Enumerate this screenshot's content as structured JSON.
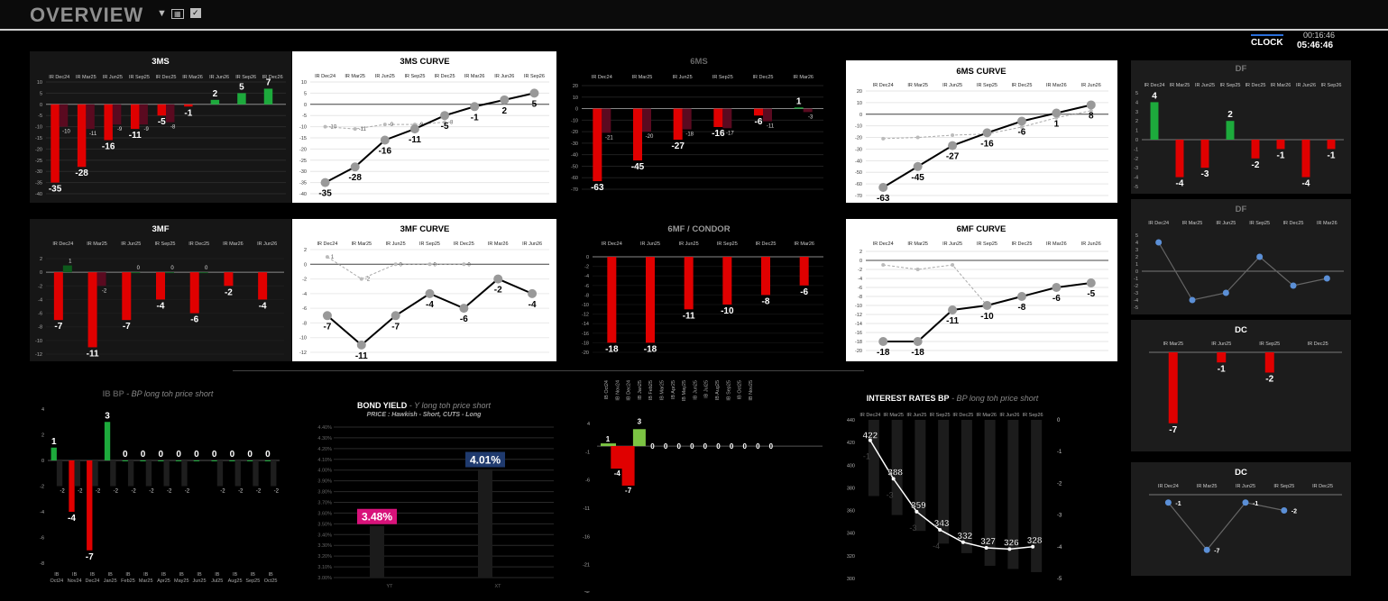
{
  "header": {
    "title": "OVERVIEW",
    "clock_label": "CLOCK",
    "clock_elapsed": "00:16:46",
    "clock_time": "05:46:46"
  },
  "colors": {
    "neg": "#e00000",
    "pos": "#1daa3c",
    "neg_dark": "#5a0a20",
    "pos_dark": "#0d5a1c",
    "gray": "#333333",
    "bond_yt": "#d8127a",
    "bond_xt": "#1f3a6e",
    "blue": "#5b8fd6",
    "bright_green": "#7cc443"
  },
  "chart_data": [
    {
      "id": "c3ms",
      "type": "bar",
      "title": "3MS",
      "theme": "dark",
      "categories": [
        "IR Dec24",
        "IR Mar25",
        "IR Jun25",
        "IR Sep25",
        "IR Dec25",
        "IR Mar26",
        "IR Jun26",
        "IR Sep26",
        "IR Dec26"
      ],
      "series": [
        {
          "role": "main",
          "values": [
            -35,
            -28,
            -16,
            -11,
            -5,
            -1,
            2,
            5,
            7
          ],
          "labels": [
            "-35",
            "-28",
            "-16",
            "-11",
            "-5",
            "-1",
            "2",
            "5",
            "7"
          ]
        },
        {
          "role": "prev",
          "values": [
            -10,
            -11,
            -9,
            -9,
            -8,
            null,
            null,
            null,
            null
          ],
          "labels": [
            "-10",
            "-11",
            "-9",
            "-9",
            "-8",
            "",
            "",
            "",
            ""
          ]
        }
      ],
      "ylim": [
        -40,
        10
      ],
      "yticks": [
        10,
        5,
        0,
        -5,
        -10,
        -15,
        -20,
        -25,
        -30,
        -35,
        -40
      ]
    },
    {
      "id": "c3msc",
      "type": "line",
      "title": "3MS CURVE",
      "theme": "light",
      "categories": [
        "IR Dec24",
        "IR Mar25",
        "IR Jun25",
        "IR Sep25",
        "IR Dec25",
        "IR Mar26",
        "IR Jun26",
        "IR Sep26"
      ],
      "series": [
        {
          "role": "main",
          "values": [
            -35,
            -28,
            -16,
            -11,
            -5,
            -1,
            2,
            5
          ],
          "labels": [
            "-35",
            "-28",
            "-16",
            "-11",
            "-5",
            "-1",
            "2",
            "5"
          ]
        },
        {
          "role": "prev",
          "values": [
            -10,
            -11,
            -9,
            -9,
            -8,
            null,
            null,
            null
          ],
          "labels": [
            "-10",
            "-11",
            "-9",
            "-9",
            "-8",
            "",
            "",
            ""
          ]
        }
      ],
      "ylim": [
        -40,
        10
      ],
      "yticks": [
        10,
        5,
        0,
        -5,
        -10,
        -15,
        -20,
        -25,
        -30,
        -35,
        -40
      ]
    },
    {
      "id": "c6ms",
      "type": "bar",
      "title": "6MS",
      "theme": "dark",
      "categories": [
        "IR Dec24",
        "IR Mar25",
        "IR Jun25",
        "IR Sep25",
        "IR Dec25",
        "IR Mar26"
      ],
      "series": [
        {
          "role": "main",
          "values": [
            -63,
            -45,
            -27,
            -16,
            -6,
            1
          ],
          "labels": [
            "-63",
            "-45",
            "-27",
            "-16",
            "-6",
            "1"
          ]
        },
        {
          "role": "prev",
          "values": [
            -21,
            -20,
            -18,
            -17,
            -11,
            -3
          ],
          "labels": [
            "-21",
            "-20",
            "-18",
            "-17",
            "-11",
            "-3"
          ]
        }
      ],
      "ylim": [
        -70,
        20
      ],
      "yticks": [
        20,
        10,
        0,
        -10,
        -20,
        -30,
        -40,
        -50,
        -60,
        -70
      ]
    },
    {
      "id": "c6msc",
      "type": "line",
      "title": "6MS CURVE",
      "theme": "light",
      "categories": [
        "IR Dec24",
        "IR Mar25",
        "IR Jun25",
        "IR Sep25",
        "IR Dec25",
        "IR Mar26",
        "IR Jun26"
      ],
      "series": [
        {
          "role": "main",
          "values": [
            -63,
            -45,
            -27,
            -16,
            -6,
            1,
            8
          ],
          "labels": [
            "-63",
            "-45",
            "-27",
            "-16",
            "-6",
            "1",
            "8"
          ]
        },
        {
          "role": "prev",
          "values": [
            -21,
            -20,
            -18,
            -17,
            -11,
            -3,
            3
          ],
          "labels": [
            "",
            "",
            "",
            "",
            "",
            "",
            ""
          ]
        }
      ],
      "ylim": [
        -70,
        20
      ],
      "yticks": [
        20,
        10,
        0,
        -10,
        -20,
        -30,
        -40,
        -50,
        -60,
        -70
      ]
    },
    {
      "id": "cdf1",
      "type": "bar",
      "title": "DF",
      "theme": "dark2",
      "categories": [
        "IR Dec24",
        "IR Mar25",
        "IR Jun25",
        "IR Sep25",
        "IR Dec25",
        "IR Mar26",
        "IR Jun26",
        "IR Sep26"
      ],
      "series": [
        {
          "role": "main",
          "values": [
            4,
            -4,
            -3,
            2,
            -2,
            -1,
            -4,
            -1
          ],
          "labels": [
            "4",
            "-4",
            "-3",
            "2",
            "-2",
            "-1",
            "-4",
            "-1"
          ]
        }
      ],
      "ylim": [
        -5,
        5
      ],
      "yticks": [
        5,
        4,
        3,
        2,
        1,
        0,
        -1,
        -2,
        -3,
        -4,
        -5
      ]
    },
    {
      "id": "c3mf",
      "type": "bar",
      "title": "3MF",
      "theme": "dark",
      "categories": [
        "IR Dec24",
        "IR Mar25",
        "IR Jun25",
        "IR Sep25",
        "IR Dec25",
        "IR Mar26",
        "IR Jun26"
      ],
      "series": [
        {
          "role": "main",
          "values": [
            -7,
            -11,
            -7,
            -4,
            -6,
            -2,
            -4
          ],
          "labels": [
            "-7",
            "-11",
            "-7",
            "-4",
            "-6",
            "-2",
            "-4"
          ]
        },
        {
          "role": "prev",
          "values": [
            1,
            -2,
            0,
            0,
            0,
            null,
            null
          ],
          "labels": [
            "1",
            "-2",
            "0",
            "0",
            "0",
            "",
            ""
          ]
        }
      ],
      "ylim": [
        -12,
        2
      ],
      "yticks": [
        2,
        0,
        -2,
        -4,
        -6,
        -8,
        -10,
        -12
      ]
    },
    {
      "id": "c3mfc",
      "type": "line",
      "title": "3MF CURVE",
      "theme": "light",
      "categories": [
        "IR Dec24",
        "IR Mar25",
        "IR Jun25",
        "IR Sep25",
        "IR Dec25",
        "IR Mar26",
        "IR Jun26"
      ],
      "series": [
        {
          "role": "main",
          "values": [
            -7,
            -11,
            -7,
            -4,
            -6,
            -2,
            -4
          ],
          "labels": [
            "-7",
            "-11",
            "-7",
            "-4",
            "-6",
            "-2",
            "-4"
          ]
        },
        {
          "role": "prev",
          "values": [
            1,
            -2,
            0,
            0,
            0,
            null,
            null
          ],
          "labels": [
            "1",
            "-2",
            "0",
            "0",
            "0",
            "",
            ""
          ]
        }
      ],
      "ylim": [
        -12,
        2
      ],
      "yticks": [
        2,
        0,
        -2,
        -4,
        -6,
        -8,
        -10,
        -12
      ]
    },
    {
      "id": "c6mf",
      "type": "bar",
      "title": "6MF / CONDOR",
      "theme": "dark",
      "categories": [
        "IR Dec24",
        "IR Jun25",
        "IR Jun25",
        "IR Sep25",
        "IR Dec25",
        "IR Mar26"
      ],
      "series": [
        {
          "role": "main",
          "values": [
            -18,
            -18,
            -11,
            -10,
            -8,
            -6
          ],
          "labels": [
            "-18",
            "-18",
            "-11",
            "-10",
            "-8",
            "-6"
          ]
        }
      ],
      "ylim": [
        -20,
        0
      ],
      "yticks": [
        0,
        -2,
        -4,
        -6,
        -8,
        -10,
        -12,
        -14,
        -16,
        -18,
        -20
      ]
    },
    {
      "id": "c6mfc",
      "type": "line",
      "title": "6MF CURVE",
      "theme": "light",
      "categories": [
        "IR Dec24",
        "IR Mar25",
        "IR Jun25",
        "IR Sep25",
        "IR Dec25",
        "IR Mar26",
        "IR Jun26"
      ],
      "series": [
        {
          "role": "main",
          "values": [
            -18,
            -18,
            -11,
            -10,
            -8,
            -6,
            -5
          ],
          "labels": [
            "-18",
            "-18",
            "-11",
            "-10",
            "-8",
            "-6",
            "-5"
          ]
        },
        {
          "role": "prev",
          "values": [
            -1,
            -2,
            -1,
            -10,
            -8,
            -6,
            -5
          ],
          "labels": [
            "",
            "",
            "",
            "",
            "",
            "",
            ""
          ]
        }
      ],
      "ylim": [
        -20,
        2
      ],
      "yticks": [
        2,
        0,
        -2,
        -4,
        -6,
        -8,
        -10,
        -12,
        -14,
        -16,
        -18,
        -20
      ]
    },
    {
      "id": "cdf2",
      "type": "line",
      "title": "DF",
      "theme": "dark2",
      "categories": [
        "IR Dec24",
        "IR Mar25",
        "IR Jun25",
        "IR Sep25",
        "IR Dec25",
        "IR Mar26"
      ],
      "series": [
        {
          "role": "main",
          "values": [
            4,
            -4,
            -3,
            2,
            -2,
            -1
          ],
          "labels": [
            "",
            "",
            "",
            "",
            "",
            ""
          ]
        }
      ],
      "ylim": [
        -5,
        5
      ],
      "yticks": [
        5,
        4,
        3,
        2,
        1,
        0,
        -1,
        -2,
        -3,
        -4,
        -5
      ]
    },
    {
      "id": "cdc1",
      "type": "bar",
      "title": "DC",
      "theme": "dark2",
      "categories": [
        "IR Mar25",
        "IR Jun25",
        "IR Sep25",
        "IR Dec25"
      ],
      "series": [
        {
          "role": "main",
          "values": [
            -7,
            -1,
            -2,
            null
          ],
          "labels": [
            "-7",
            "-1",
            "-2",
            ""
          ]
        }
      ],
      "ylim": [
        -8,
        0
      ],
      "yticks": []
    },
    {
      "id": "cdc2",
      "type": "line",
      "title": "DC",
      "theme": "dark2",
      "categories": [
        "IR Dec24",
        "IR Mar25",
        "IR Jun25",
        "IR Sep25",
        "IR Dec25"
      ],
      "series": [
        {
          "role": "main",
          "values": [
            -1,
            -7,
            -1,
            -2,
            null
          ],
          "labels": [
            "-1",
            "-7",
            "-1",
            "-2",
            ""
          ]
        }
      ],
      "ylim": [
        -8,
        0
      ],
      "yticks": []
    },
    {
      "id": "cib",
      "type": "bar",
      "title": "IB BP",
      "subtitle": "BP long toh price short",
      "theme": "black",
      "categories": [
        "IB Oct24",
        "IB Nov24",
        "IB Dec24",
        "IB Jan25",
        "IB Feb25",
        "IB Mar25",
        "IB Apr25",
        "IB May25",
        "IB Jun25",
        "IB Jul25",
        "IB Aug25",
        "IB Sep25",
        "IB Oct25"
      ],
      "series": [
        {
          "role": "main",
          "values": [
            1,
            -4,
            -7,
            3,
            0,
            0,
            0,
            0,
            0,
            0,
            0,
            0,
            0
          ],
          "labels": [
            "1",
            "-4",
            "-7",
            "3",
            "0",
            "0",
            "0",
            "0",
            "0",
            "0",
            "0",
            "0",
            "0"
          ]
        },
        {
          "role": "prev",
          "values": [
            -2,
            -2,
            -2,
            -2,
            -2,
            -2,
            -2,
            -2,
            null,
            -2,
            -2,
            -2,
            -2
          ],
          "labels": [
            "-2",
            "-2",
            "-2",
            "-2",
            "-2",
            "-2",
            "-2",
            "-2",
            "",
            "-2",
            "-2",
            "-2",
            "-2"
          ]
        }
      ],
      "ylim": [
        -8,
        4
      ],
      "yticks": [
        4,
        2,
        0,
        -2,
        -4,
        -6,
        -8
      ]
    },
    {
      "id": "cbond",
      "type": "bar",
      "title": "BOND YIELD",
      "subtitle": "Y long toh price short",
      "subtitle2": "PRICE : Hawkish - Short, CUTS - Long",
      "theme": "black",
      "categories": [
        "YT",
        "XT"
      ],
      "series": [
        {
          "role": "main",
          "values": [
            3.48,
            4.01
          ],
          "labels": [
            "3.48%",
            "4.01%"
          ]
        }
      ],
      "ylim": [
        3.0,
        4.4
      ],
      "yticks": [
        "4.40%",
        "4.30%",
        "4.20%",
        "4.10%",
        "4.00%",
        "3.90%",
        "3.80%",
        "3.70%",
        "3.60%",
        "3.50%",
        "3.40%",
        "3.30%",
        "3.20%",
        "3.10%",
        "3.00%"
      ]
    },
    {
      "id": "cmid",
      "type": "bar",
      "theme": "black",
      "categories": [
        "IB Oct24",
        "IB Nov24",
        "IB Dec24",
        "IB Jan25",
        "IB Feb25",
        "IB Mar25",
        "IB Apr25",
        "IB May25",
        "IB Jun25",
        "IB Jul25",
        "IB Aug25",
        "IB Sep25",
        "IB Oct25",
        "IB Nov25"
      ],
      "series": [
        {
          "role": "main",
          "values": [
            1,
            -4,
            -7,
            3,
            0,
            0,
            0,
            0,
            0,
            0,
            0,
            0,
            0,
            0
          ],
          "labels": [
            "1",
            "-4",
            "-7",
            "3",
            "0",
            "0",
            "0",
            "0",
            "0",
            "0",
            "0",
            "0",
            "0",
            "0"
          ]
        }
      ],
      "ylim": [
        -26,
        4
      ],
      "yticks": [
        4,
        -1,
        -6,
        -11,
        -16,
        -21,
        -26
      ]
    },
    {
      "id": "cir",
      "type": "combo",
      "title": "INTEREST RATES BP",
      "subtitle": "BP long toh price short",
      "theme": "black",
      "categories": [
        "IR Dec24",
        "IR Mar25",
        "IR Jun25",
        "IR Sep25",
        "IR Dec25",
        "IR Mar26",
        "IR Jun26",
        "IR Sep26"
      ],
      "series": [
        {
          "role": "main",
          "values": [
            422,
            388,
            359,
            343,
            332,
            327,
            326,
            328
          ],
          "labels": [
            "422",
            "388",
            "359",
            "343",
            "332",
            "327",
            "326",
            "328"
          ]
        },
        {
          "role": "prev",
          "values": [
            -1,
            -3,
            -3,
            -4,
            null,
            null,
            null,
            null
          ],
          "labels": [
            "-1",
            "-3",
            "-3",
            "-4",
            "",
            "",
            "",
            ""
          ]
        }
      ],
      "ylim": [
        300,
        440
      ],
      "yticks": [
        440,
        420,
        400,
        380,
        360,
        340,
        320,
        300
      ],
      "y2ticks": [
        0,
        -1,
        -2,
        -3,
        -4,
        -5
      ]
    }
  ]
}
